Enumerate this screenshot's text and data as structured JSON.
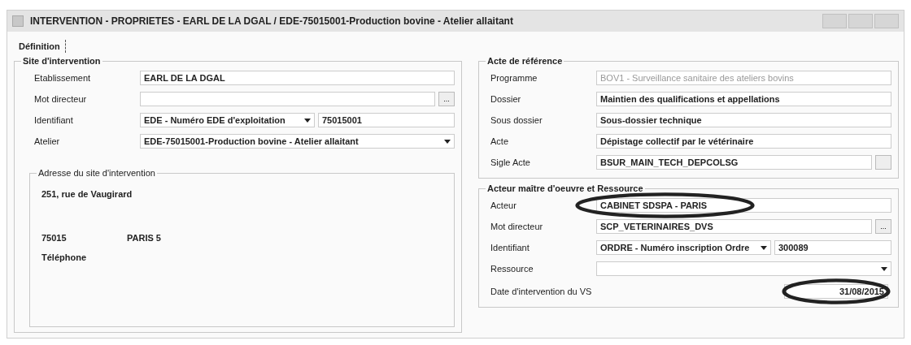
{
  "window": {
    "title": "INTERVENTION - PROPRIETES - EARL DE LA DGAL / EDE-75015001-Production bovine - Atelier allaitant"
  },
  "tabs": [
    {
      "label": "Définition",
      "selected": true
    }
  ],
  "site": {
    "title": "Site d'intervention",
    "fields": [
      {
        "label": "Etablissement",
        "kind": "text",
        "value": "EARL DE LA DGAL"
      },
      {
        "label": "Mot directeur",
        "kind": "browse",
        "button": "..."
      },
      {
        "label": "Identifiant",
        "kind": "pair",
        "value": "EDE - Numéro EDE d'exploitation",
        "value_2": "75015001"
      },
      {
        "label": "Atelier",
        "kind": "combo",
        "value": "EDE-75015001-Production bovine - Atelier allaitant"
      }
    ]
  },
  "address": {
    "title": "Adresse du site d'intervention",
    "street": "251, rue de Vaugirard",
    "postcode": "75015",
    "city": "PARIS 5",
    "phone_label": "Téléphone"
  },
  "reference": {
    "title": "Acte de référence",
    "fields": [
      {
        "label": "Programme",
        "kind": "text",
        "value": "BOV1 - Surveillance sanitaire des ateliers bovins",
        "disabled": true
      },
      {
        "label": "Dossier",
        "kind": "text",
        "value": "Maintien des qualifications et appellations",
        "disabled": false
      },
      {
        "label": "Sous dossier",
        "kind": "text",
        "value": "Sous-dossier technique",
        "disabled": false
      },
      {
        "label": "Acte",
        "kind": "text",
        "value": "Dépistage collectif par le vétérinaire",
        "disabled": false
      },
      {
        "label": "Sigle Acte",
        "kind": "browse",
        "value": "BSUR_MAIN_TECH_DEPCOLSG",
        "disabled": false
      }
    ]
  },
  "actor": {
    "title": "Acteur maître d'oeuvre et Ressource",
    "fields": [
      {
        "label": "Acteur",
        "kind": "text",
        "value": "CABINET SDSPA - PARIS",
        "circled": true
      },
      {
        "label": "Mot directeur",
        "kind": "browse",
        "value": "SCP_VETERINAIRES_DVS",
        "button": "...",
        "circled": false
      },
      {
        "label": "Identifiant",
        "kind": "pair",
        "value": "ORDRE - Numéro inscription Ordre",
        "value_2": "300089",
        "circled": false
      },
      {
        "label": "Ressource",
        "kind": "combo",
        "circled": false
      }
    ],
    "date_label": "Date d'intervention du VS",
    "date": "31/08/2015",
    "date_circled": true
  }
}
